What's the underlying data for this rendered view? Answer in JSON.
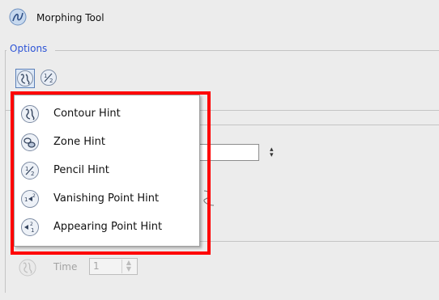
{
  "window": {
    "title": "Morphing Tool",
    "icon": "morphing-tool-icon"
  },
  "options": {
    "legend": "Options",
    "tool_buttons": [
      {
        "icon": "contour-hint-icon",
        "active": true
      },
      {
        "icon": "pencil-hint-icon",
        "active": false
      }
    ]
  },
  "hint_menu": {
    "items": [
      {
        "label": "Contour Hint",
        "icon": "contour-hint-icon"
      },
      {
        "label": "Zone Hint",
        "icon": "zone-hint-icon"
      },
      {
        "label": "Pencil Hint",
        "icon": "pencil-hint-icon"
      },
      {
        "label": "Vanishing Point Hint",
        "icon": "vanishing-point-hint-icon"
      },
      {
        "label": "Appearing Point Hint",
        "icon": "appearing-point-hint-icon"
      }
    ]
  },
  "time": {
    "label": "Time",
    "value": "1",
    "enabled": false
  },
  "colors": {
    "legend": "#2d54d6",
    "annotation": "#ff0000",
    "background": "#ececec"
  }
}
